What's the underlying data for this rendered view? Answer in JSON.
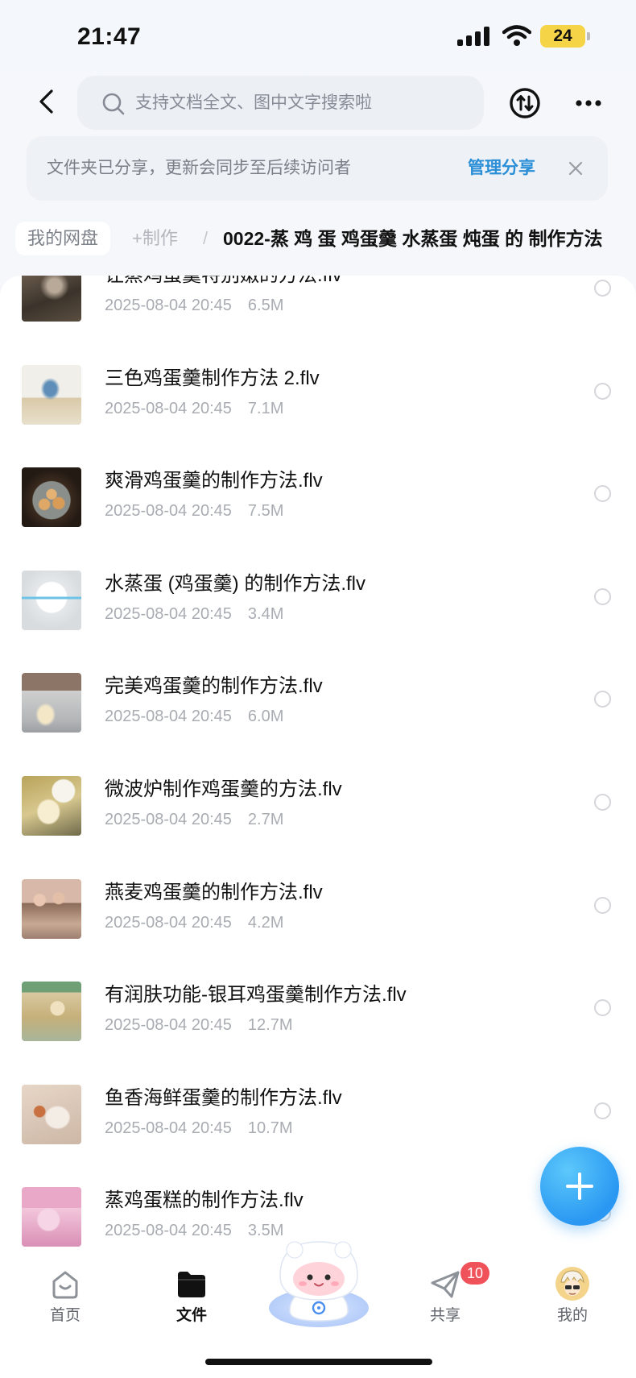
{
  "status_bar": {
    "time": "21:47",
    "battery": "24"
  },
  "header": {
    "search_placeholder": "支持文档全文、图中文字搜索啦",
    "icons": [
      "back-icon",
      "search-icon",
      "sync-icon",
      "more-icon"
    ]
  },
  "share_banner": {
    "message": "文件夹已分享，更新会同步至后续访问者",
    "manage_label": "管理分享"
  },
  "breadcrumb": {
    "root": "我的网盘",
    "parent": "+制作",
    "separator": "/",
    "current": "0022-蒸 鸡 蛋 鸡蛋羹 水蒸蛋 炖蛋 的 制作方法"
  },
  "files": [
    {
      "name": "让蒸鸡蛋羹特别嫩的方法.flv",
      "date": "2025-08-04 20:45",
      "size": "6.5M"
    },
    {
      "name": "三色鸡蛋羹制作方法 2.flv",
      "date": "2025-08-04 20:45",
      "size": "7.1M"
    },
    {
      "name": "爽滑鸡蛋羹的制作方法.flv",
      "date": "2025-08-04 20:45",
      "size": "7.5M"
    },
    {
      "name": "水蒸蛋 (鸡蛋羹) 的制作方法.flv",
      "date": "2025-08-04 20:45",
      "size": "3.4M"
    },
    {
      "name": "完美鸡蛋羹的制作方法.flv",
      "date": "2025-08-04 20:45",
      "size": "6.0M"
    },
    {
      "name": "微波炉制作鸡蛋羹的方法.flv",
      "date": "2025-08-04 20:45",
      "size": "2.7M"
    },
    {
      "name": "燕麦鸡蛋羹的制作方法.flv",
      "date": "2025-08-04 20:45",
      "size": "4.2M"
    },
    {
      "name": "有润肤功能-银耳鸡蛋羹制作方法.flv",
      "date": "2025-08-04 20:45",
      "size": "12.7M"
    },
    {
      "name": "鱼香海鲜蛋羹的制作方法.flv",
      "date": "2025-08-04 20:45",
      "size": "10.7M"
    },
    {
      "name": "蒸鸡蛋糕的制作方法.flv",
      "date": "2025-08-04 20:45",
      "size": "3.5M"
    }
  ],
  "bottom_nav": {
    "home": {
      "label": "首页",
      "icon": "home-icon"
    },
    "files": {
      "label": "文件",
      "icon": "folder-icon",
      "active": true
    },
    "assistant": {
      "icon": "mascot-icon"
    },
    "share": {
      "label": "共享",
      "icon": "paper-plane-icon",
      "badge": "10"
    },
    "me": {
      "label": "我的",
      "icon": "avatar-icon"
    }
  },
  "colors": {
    "accent": "#2a8fd6",
    "fab": "#2a98f2",
    "badge": "#f0525a",
    "battery": "#f5d447"
  }
}
